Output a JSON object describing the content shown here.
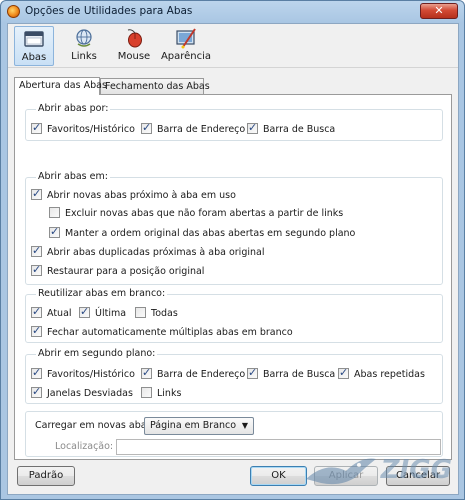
{
  "window": {
    "title": "Opções de Utilidades para Abas",
    "close_label": "✕"
  },
  "toolbar": {
    "items": [
      {
        "label": "Abas",
        "icon": "tabs-icon",
        "selected": true
      },
      {
        "label": "Links",
        "icon": "globe-link-icon",
        "selected": false
      },
      {
        "label": "Mouse",
        "icon": "mouse-icon",
        "selected": false
      },
      {
        "label": "Aparência",
        "icon": "paint-icon",
        "selected": false
      }
    ]
  },
  "tabs": [
    {
      "label": "Abertura das Abas",
      "active": true
    },
    {
      "label": "Fechamento das Abas",
      "active": false
    }
  ],
  "groups": {
    "abrir_por": {
      "title": "Abrir abas por:",
      "options": [
        {
          "label": "Favoritos/Histórico",
          "checked": true
        },
        {
          "label": "Barra de Endereço",
          "checked": true
        },
        {
          "label": "Barra de Busca",
          "checked": true
        }
      ]
    },
    "abrir_em": {
      "title": "Abrir abas em:",
      "options": [
        {
          "label": "Abrir novas abas próximo à aba em uso",
          "checked": true
        },
        {
          "label": "Excluir novas abas que não foram abertas a partir de links",
          "checked": false
        },
        {
          "label": "Manter a ordem original das abas abertas em segundo plano",
          "checked": true
        },
        {
          "label": "Abrir abas duplicadas próximas à aba original",
          "checked": true
        },
        {
          "label": "Restaurar para a posição original",
          "checked": true
        }
      ]
    },
    "reutilizar": {
      "title": "Reutilizar abas em branco:",
      "options": [
        {
          "label": "Atual",
          "checked": true
        },
        {
          "label": "Última",
          "checked": true
        },
        {
          "label": "Todas",
          "checked": false
        },
        {
          "label": "Fechar automaticamente múltiplas abas em branco",
          "checked": true
        }
      ]
    },
    "segundo_plano": {
      "title": "Abrir em segundo plano:",
      "options": [
        {
          "label": "Favoritos/Histórico",
          "checked": true
        },
        {
          "label": "Barra de Endereço",
          "checked": true
        },
        {
          "label": "Barra de Busca",
          "checked": true
        },
        {
          "label": "Abas repetidas",
          "checked": true
        },
        {
          "label": "Janelas Desviadas",
          "checked": true
        },
        {
          "label": "Links",
          "checked": false
        }
      ]
    },
    "carregar": {
      "label": "Carregar em novas abas:",
      "selected": "Página em Branco",
      "location_label": "Localização:",
      "location_value": ""
    }
  },
  "buttons": {
    "default": "Padrão",
    "ok": "OK",
    "apply": "Aplicar",
    "cancel": "Cancelar"
  },
  "watermark": "ZIGG"
}
